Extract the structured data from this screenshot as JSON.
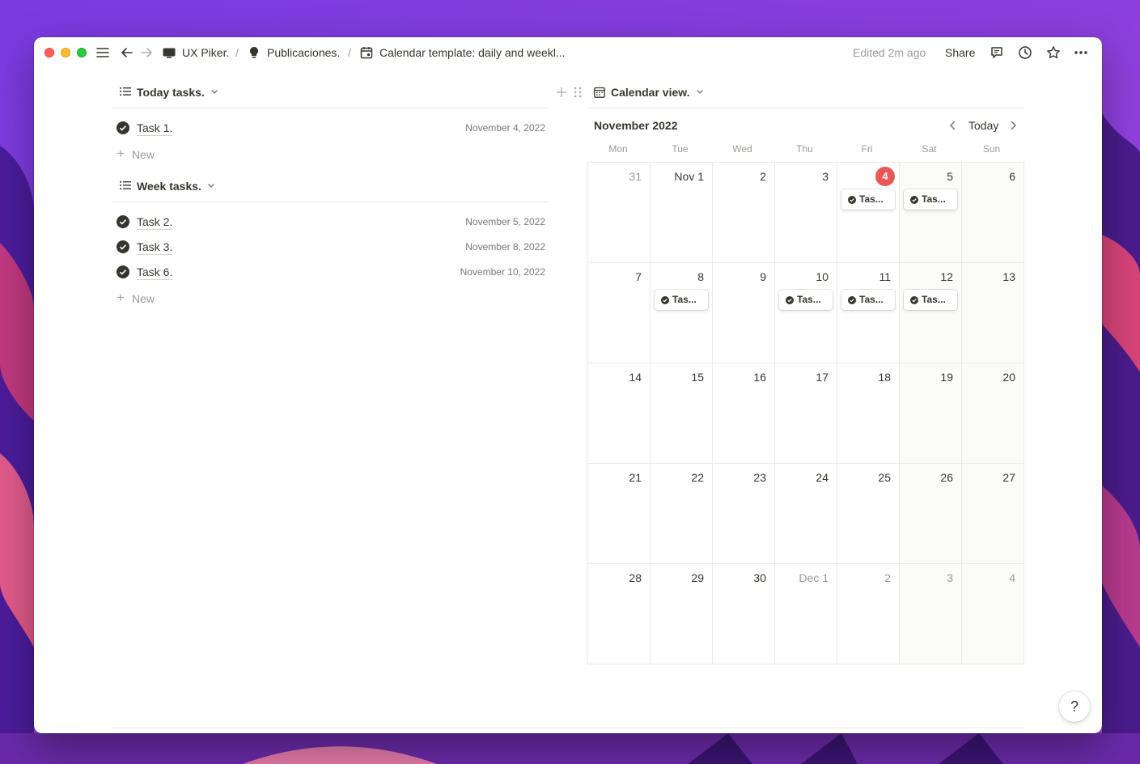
{
  "breadcrumb": [
    {
      "label": "UX Piker.",
      "icon": "workspace-icon"
    },
    {
      "label": "Publicaciones.",
      "icon": "lightbulb-icon"
    },
    {
      "label": "Calendar template: daily and weekl...",
      "icon": "calendar-icon"
    }
  ],
  "breadcrumb_separator": "/",
  "topbar": {
    "edited": "Edited 2m ago",
    "share_label": "Share"
  },
  "today_section": {
    "title": "Today tasks.",
    "tasks": [
      {
        "name": "Task 1.",
        "date": "November 4, 2022"
      }
    ],
    "new_label": "New"
  },
  "week_section": {
    "title": "Week tasks.",
    "tasks": [
      {
        "name": "Task 2.",
        "date": "November 5, 2022"
      },
      {
        "name": "Task 3.",
        "date": "November 8, 2022"
      },
      {
        "name": "Task 6.",
        "date": "November 10, 2022"
      }
    ],
    "new_label": "New"
  },
  "calendar": {
    "view_title": "Calendar view.",
    "month_label": "November 2022",
    "today_label": "Today",
    "weekdays": [
      "Mon",
      "Tue",
      "Wed",
      "Thu",
      "Fri",
      "Sat",
      "Sun"
    ],
    "today_accent": "#eb5757",
    "weeks": [
      [
        {
          "label": "31",
          "other": true
        },
        {
          "label": "Nov 1"
        },
        {
          "label": "2"
        },
        {
          "label": "3"
        },
        {
          "label": "4",
          "today": true,
          "card": "Tas..."
        },
        {
          "label": "5",
          "card": "Tas..."
        },
        {
          "label": "6"
        }
      ],
      [
        {
          "label": "7"
        },
        {
          "label": "8",
          "card": "Tas..."
        },
        {
          "label": "9"
        },
        {
          "label": "10",
          "card": "Tas..."
        },
        {
          "label": "11",
          "card": "Tas..."
        },
        {
          "label": "12",
          "card": "Tas..."
        },
        {
          "label": "13"
        }
      ],
      [
        {
          "label": "14"
        },
        {
          "label": "15"
        },
        {
          "label": "16"
        },
        {
          "label": "17"
        },
        {
          "label": "18"
        },
        {
          "label": "19"
        },
        {
          "label": "20"
        }
      ],
      [
        {
          "label": "21"
        },
        {
          "label": "22"
        },
        {
          "label": "23"
        },
        {
          "label": "24"
        },
        {
          "label": "25"
        },
        {
          "label": "26"
        },
        {
          "label": "27"
        }
      ],
      [
        {
          "label": "28"
        },
        {
          "label": "29"
        },
        {
          "label": "30"
        },
        {
          "label": "Dec 1",
          "other": true
        },
        {
          "label": "2",
          "other": true
        },
        {
          "label": "3",
          "other": true
        },
        {
          "label": "4",
          "other": true
        }
      ]
    ]
  },
  "help_label": "?"
}
